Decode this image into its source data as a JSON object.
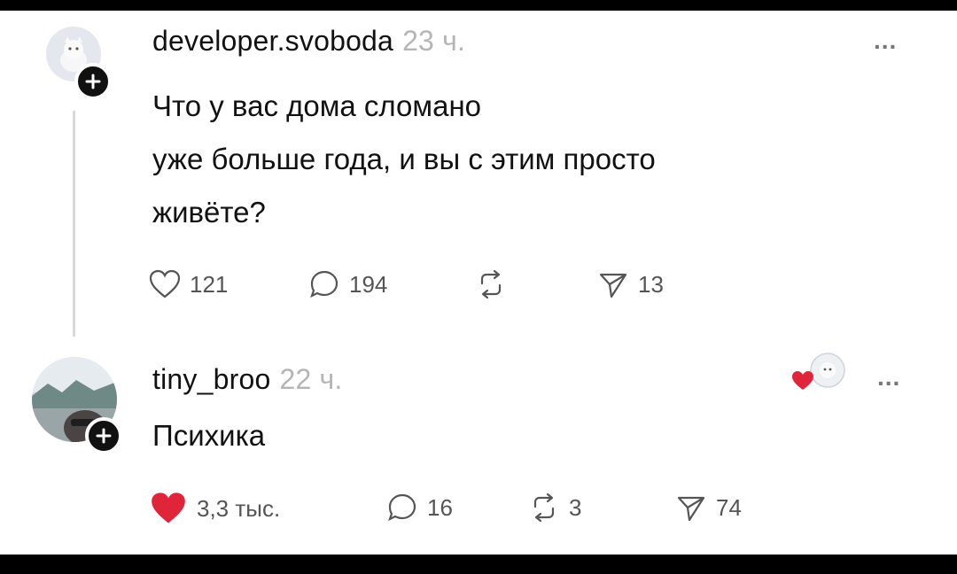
{
  "post": {
    "username": "developer.svoboda",
    "time": "23 ч.",
    "more": "...",
    "lines": [
      "Что у вас дома сломано",
      "уже больше года, и вы с этим просто",
      "живёте?"
    ],
    "stats": {
      "likes": "121",
      "comments": "194",
      "reposts": "",
      "shares": "13"
    }
  },
  "reply": {
    "username": "tiny_broo",
    "time": "22 ч.",
    "more": "...",
    "text": "Психика",
    "stats": {
      "likes": "3,3 тыс.",
      "comments": "16",
      "reposts": "3",
      "shares": "74"
    },
    "liked": true
  },
  "colors": {
    "like_red": "#e0243a",
    "muted": "#555555",
    "time_gray": "#b5b5b5"
  }
}
